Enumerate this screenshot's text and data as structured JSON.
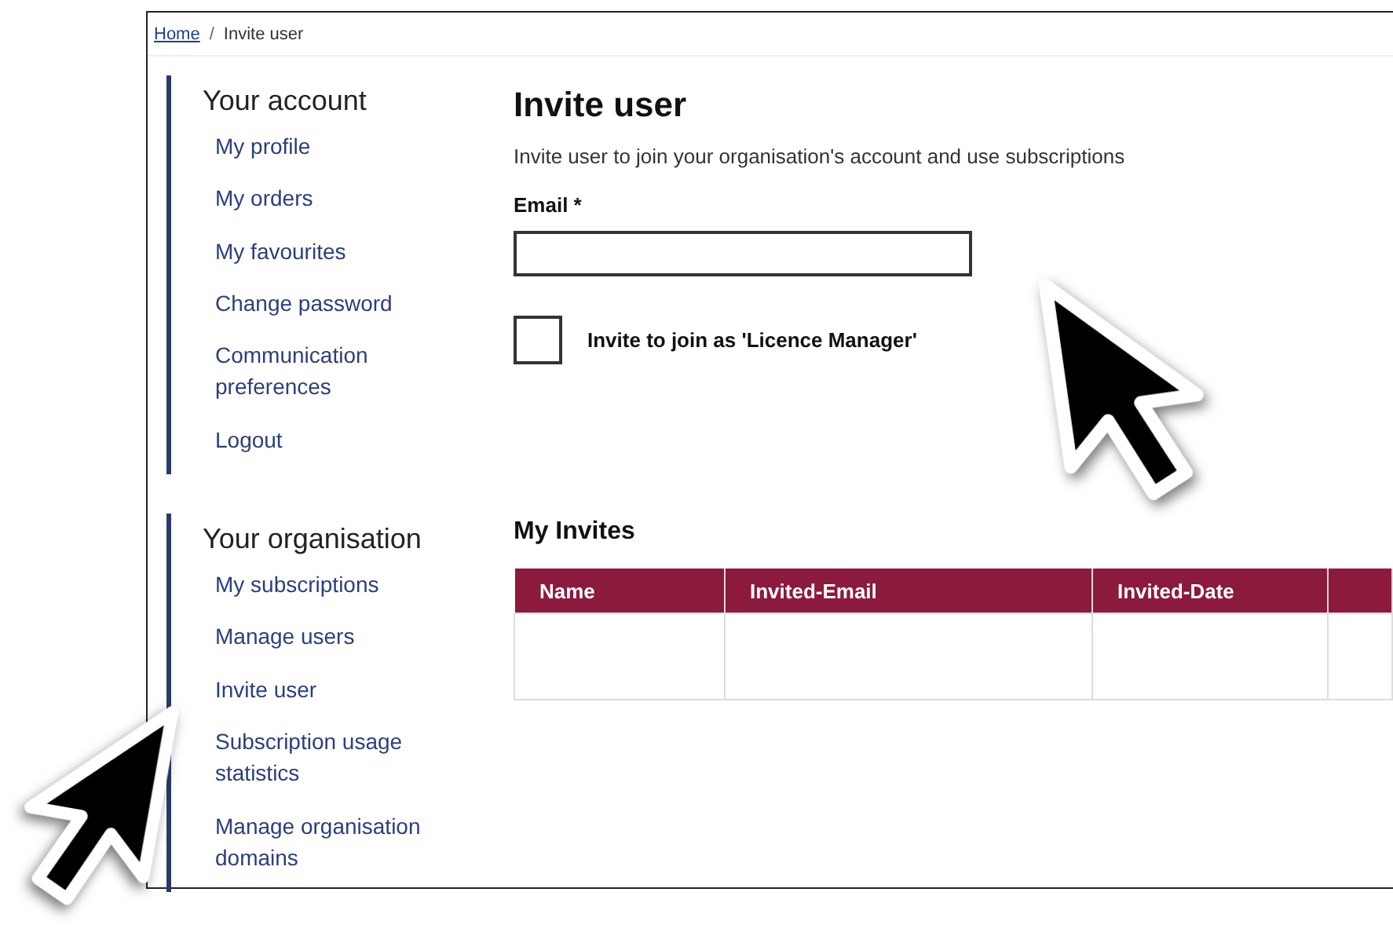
{
  "breadcrumb_separator": "/",
  "breadcrumb": [
    {
      "label": "Home",
      "link": true
    },
    {
      "label": "Invite user",
      "link": false
    }
  ],
  "sidebar": [
    {
      "heading": "Your account",
      "items": [
        "My profile",
        "My orders",
        "My favourites",
        "Change password",
        "Communication preferences",
        "Logout"
      ]
    },
    {
      "heading": "Your organisation",
      "items": [
        "My subscriptions",
        "Manage users",
        "Invite user",
        "Subscription usage statistics",
        "Manage organisation domains"
      ]
    }
  ],
  "page": {
    "title": "Invite user",
    "description": "Invite user to join your organisation's account and use subscriptions",
    "email_label": "Email *",
    "licence_checkbox": {
      "label": "Invite to join as 'Licence Manager'",
      "checked": false
    }
  },
  "invites": {
    "title": "My Invites",
    "columns": [
      "Name",
      "Invited-Email",
      "Invited-Date"
    ]
  }
}
